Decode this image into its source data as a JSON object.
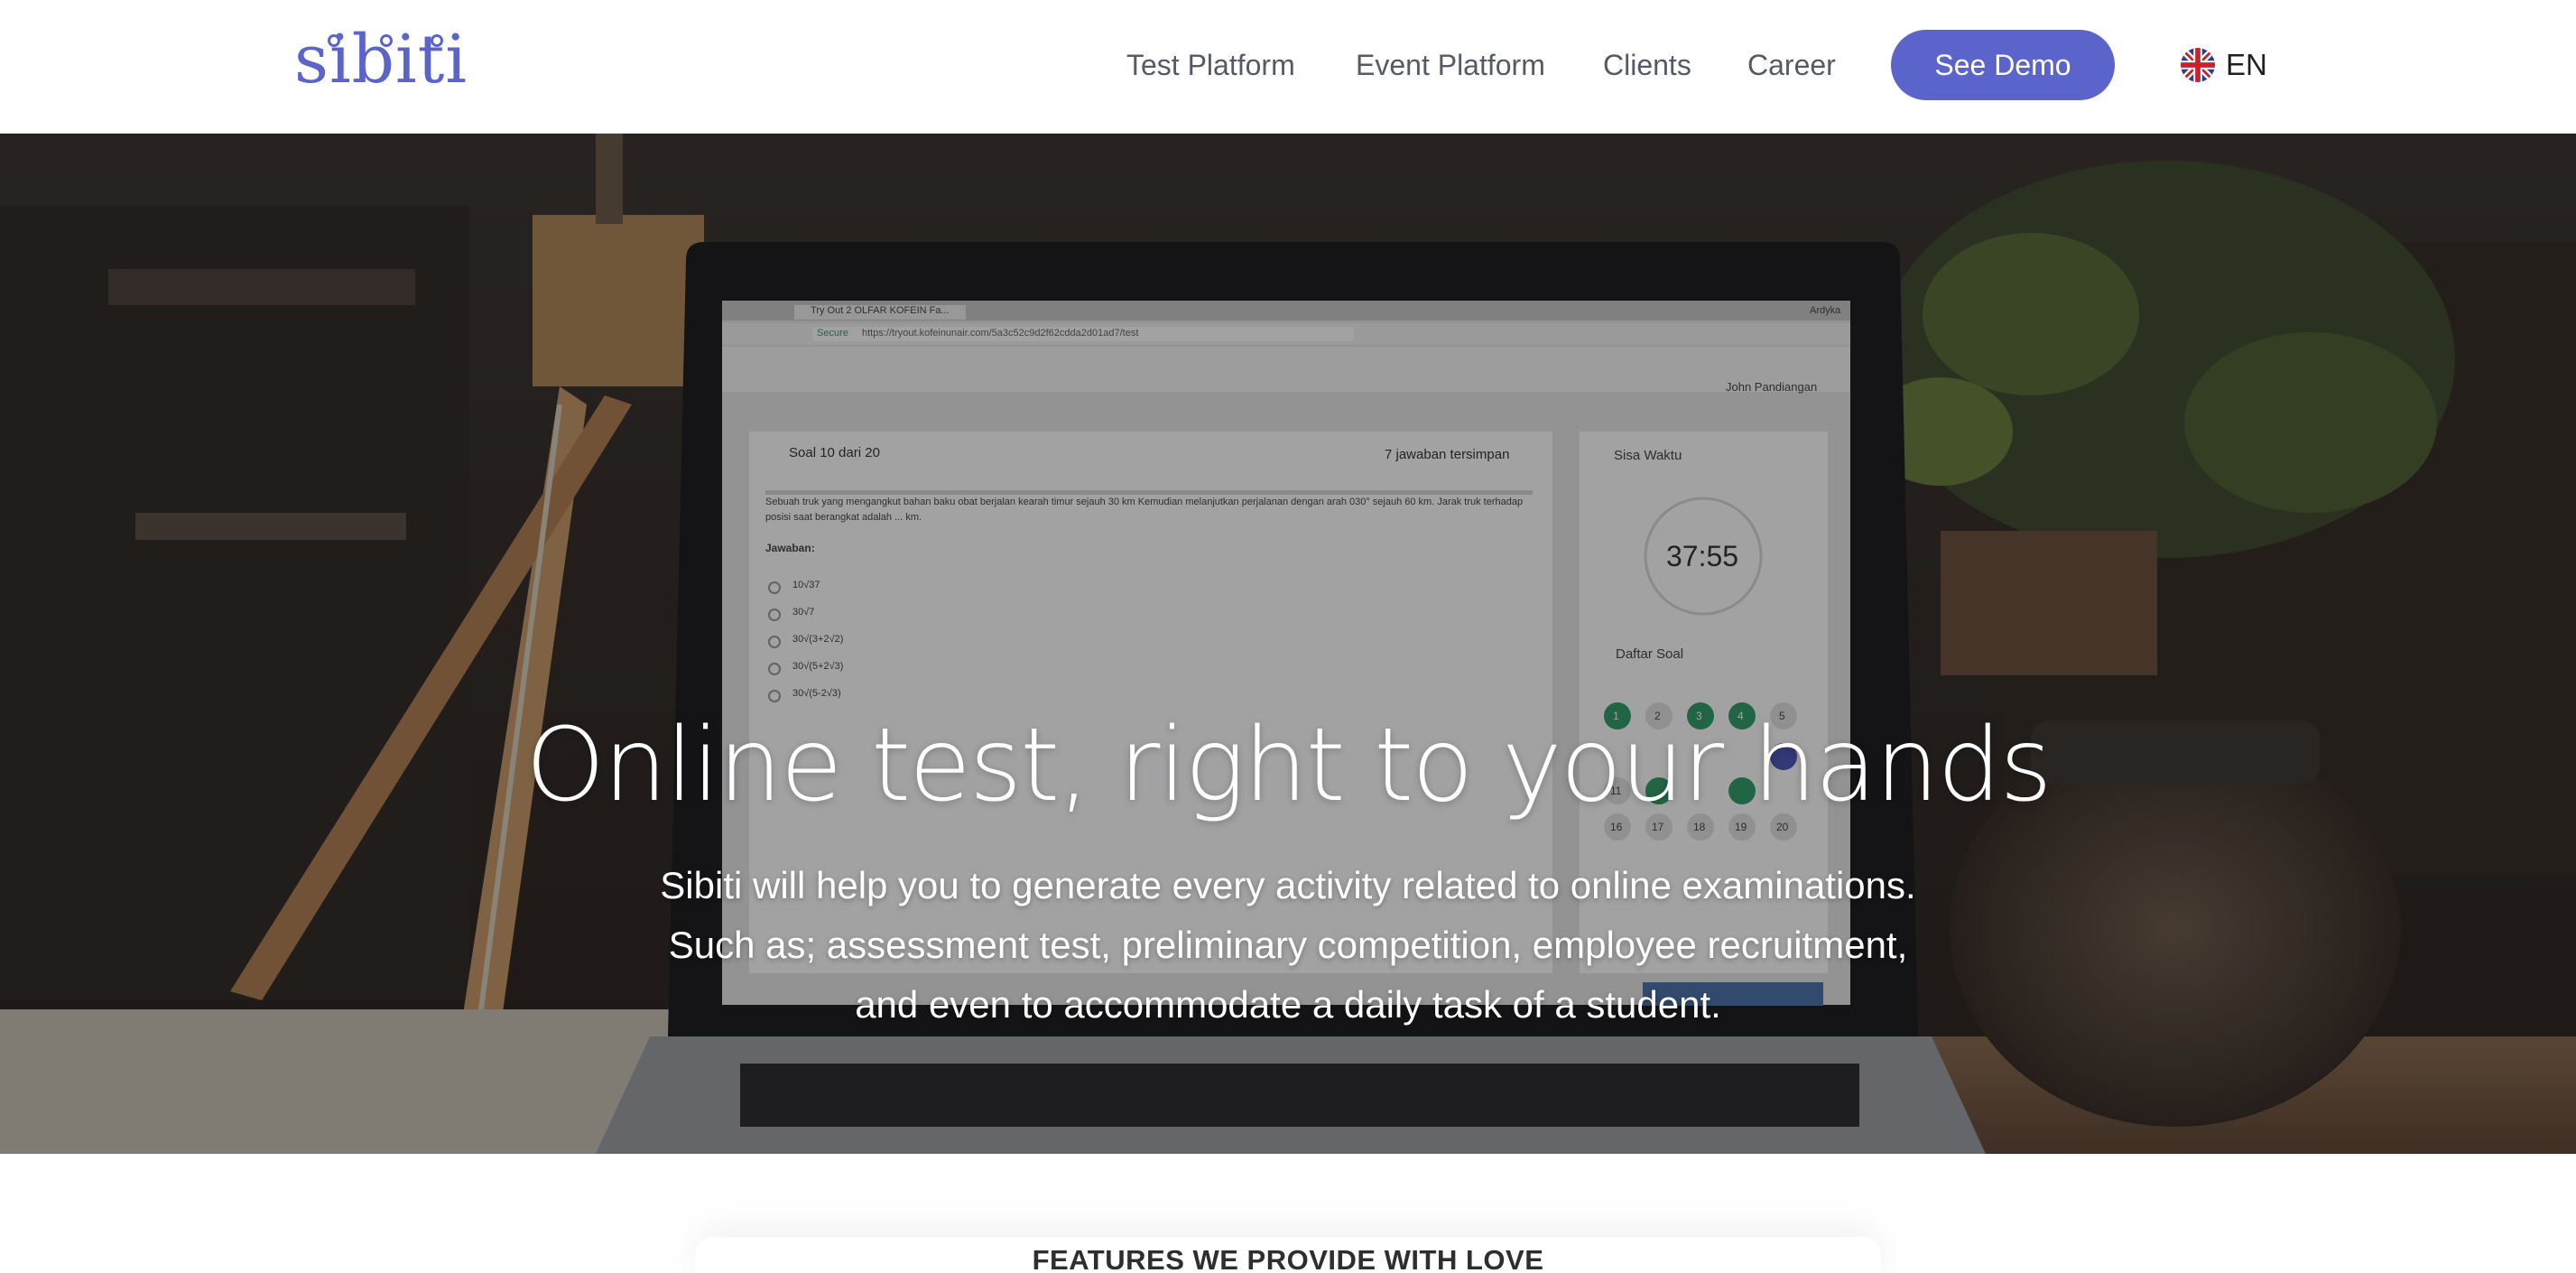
{
  "brand": {
    "name": "sibiti",
    "color": "#5b64c9"
  },
  "nav": {
    "items": [
      {
        "label": "Test Platform"
      },
      {
        "label": "Event Platform"
      },
      {
        "label": "Clients"
      },
      {
        "label": "Career"
      }
    ],
    "cta_label": "See Demo",
    "language": {
      "label": "EN",
      "icon": "uk-flag-icon"
    }
  },
  "hero": {
    "title": "Online test, right to your hands",
    "lines": [
      "Sibiti will help you to generate every activity related to online examinations.",
      "Such as; assessment test, preliminary competition, employee recruitment,",
      "and even to accommodate a daily task of a student."
    ],
    "laptop_screen": {
      "tab_title": "Try Out 2 OLFAR KOFEIN Fa...",
      "url_secure": "Secure",
      "url": "https://tryout.kofeinunair.com/5a3c52c9d2f62cdda2d01ad7/test",
      "user_top": "Ardyka",
      "user": "John Pandiangan",
      "question_label": "Soal 10 dari 20",
      "saved_label": "7 jawaban tersimpan",
      "question_text": "Sebuah truk yang mengangkut bahan baku obat berjalan kearah timur sejauh 30 km Kemudian melanjutkan perjalanan dengan arah 030° sejauh 60 km. Jarak truk terhadap posisi saat berangkat adalah ... km.",
      "answer_label": "Jawaban:",
      "options": [
        "10√37",
        "30√7",
        "30√(3+2√2)",
        "30√(5+2√3)",
        "30√(5-2√3)"
      ],
      "timer_label": "Sisa Waktu",
      "timer_value": "37:55",
      "list_label": "Daftar Soal",
      "numbers": [
        "1",
        "2",
        "3",
        "4",
        "5",
        "11",
        "16",
        "17",
        "18",
        "19",
        "20"
      ]
    }
  },
  "features": {
    "heading": "FEATURES WE PROVIDE WITH LOVE"
  },
  "colors": {
    "accent": "#5b64cb",
    "nav_text": "#555b66",
    "hero_text": "#ffffff"
  }
}
